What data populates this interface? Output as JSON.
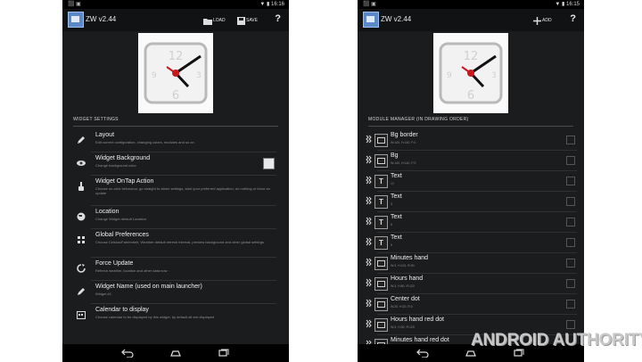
{
  "left": {
    "status_time": "16:16",
    "app_title": "ZW v2.44",
    "load_label": "LOAD",
    "save_label": "SAVE",
    "help_label": "?",
    "section_header": "WIDGET SETTINGS",
    "items": [
      {
        "title": "Layout",
        "sub": "Edit current configuration, changing colors, modules and so on",
        "icon": "pencil-icon"
      },
      {
        "title": "Widget Background",
        "sub": "Change background color",
        "icon": "eye-icon",
        "checkbox": true
      },
      {
        "title": "Widget OnTap Action",
        "sub": "Choose on-click behaviour, go straight to alarm settings, start your preferred application, do nothing or force an update",
        "icon": "hand-icon"
      },
      {
        "title": "Location",
        "sub": "Change Widget default Location",
        "icon": "globe-icon"
      },
      {
        "title": "Global Preferences",
        "sub": "Choose Celsius/Fahrenheit, Weather default refresh interval, preview background and other global settings",
        "icon": "sliders-icon"
      },
      {
        "title": "Force Update",
        "sub": "Refresh weather, location and other data now",
        "icon": "refresh-icon"
      },
      {
        "title": "Widget Name (used on main launcher)",
        "sub": "Widget #1",
        "icon": "pencil-icon"
      },
      {
        "title": "Calendar to display",
        "sub": "Choose calendar to be displayed by this widget, by default all are displayed",
        "icon": "calendar-icon"
      }
    ]
  },
  "right": {
    "status_time": "16:15",
    "app_title": "ZW v2.44",
    "add_label": "ADD",
    "help_label": "?",
    "section_header": "MODULE MANAGER (IN DRAWING ORDER)",
    "modules": [
      {
        "name": "Bg border",
        "sub": "W:140, H:140, F:0",
        "thumb": "rect"
      },
      {
        "name": "Bg",
        "sub": "W:140, H:140, F:0",
        "thumb": "rect"
      },
      {
        "name": "Text",
        "sub": "12",
        "thumb": "T"
      },
      {
        "name": "Text",
        "sub": "3",
        "thumb": "T"
      },
      {
        "name": "Text",
        "sub": "6",
        "thumb": "T"
      },
      {
        "name": "Text",
        "sub": "9",
        "thumb": "T"
      },
      {
        "name": "Minutes hand",
        "sub": "W:3, H:110, R:90",
        "thumb": "rect"
      },
      {
        "name": "Hours hand",
        "sub": "W:3, H:80, R:120",
        "thumb": "rect"
      },
      {
        "name": "Center dot",
        "sub": "W:20, H:20, R:0",
        "thumb": "rect"
      },
      {
        "name": "Hours hand red dot",
        "sub": "W:3, H:30, R:120",
        "thumb": "rect"
      },
      {
        "name": "Minutes hand red dot",
        "sub": "",
        "thumb": "rect"
      }
    ]
  },
  "watermark": "ANDROID AUTHORITY",
  "colors": {
    "accent": "#5b88c9",
    "hand_red": "#c8181e"
  }
}
